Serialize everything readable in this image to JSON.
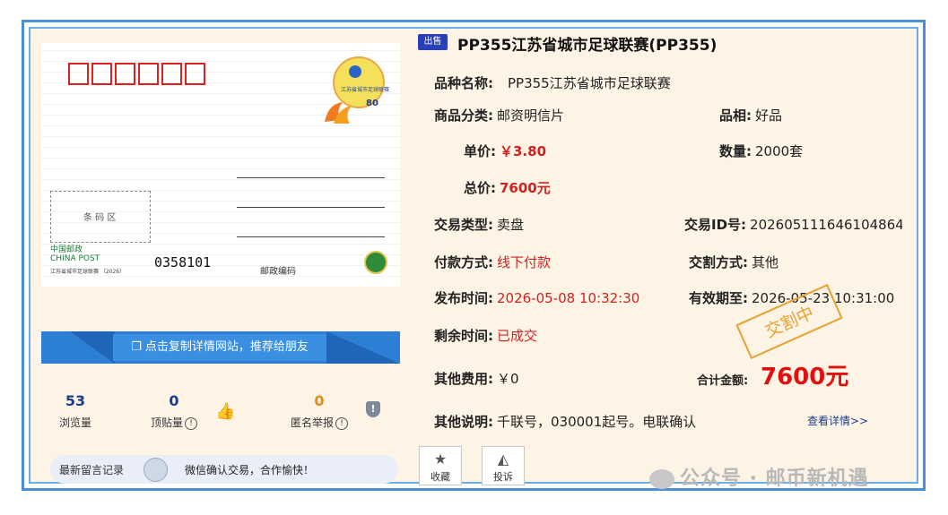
{
  "listing": {
    "badge": "出售",
    "title": "PP355江苏省城市足球联赛(PP355)"
  },
  "postcard": {
    "logo_text": "江苏省城市足球联赛",
    "logo_number": "80",
    "barcode_label": "条 码 区",
    "brand_cn": "中国邮政",
    "brand_en": "CHINA POST",
    "subtitle": "江苏省城市足球联赛 （2026）",
    "serial": "0358101",
    "postcode_label": "邮政编码"
  },
  "share": {
    "label": "点击复制详情网站，推荐给朋友"
  },
  "stats": {
    "views": {
      "value": "53",
      "label": "浏览量"
    },
    "tops": {
      "value": "0",
      "label": "顶贴量"
    },
    "reports": {
      "value": "0",
      "label": "匿名举报"
    }
  },
  "messages": {
    "label": "最新留言记录",
    "latest": "微信确认交易，合作愉快！"
  },
  "details": {
    "variety_label": "品种名称:",
    "variety_value": "PP355江苏省城市足球联赛",
    "category_label": "商品分类:",
    "category_value": "邮资明信片",
    "condition_label": "品相:",
    "condition_value": "好品",
    "unit_price_label": "单价:",
    "unit_price_value": "￥3.80",
    "quantity_label": "数量:",
    "quantity_value": "2000套",
    "total_label": "总价:",
    "total_value": "7600元",
    "trade_type_label": "交易类型:",
    "trade_type_value": "卖盘",
    "trade_id_label": "交易ID号:",
    "trade_id_value": "202605111646104864",
    "payment_label": "付款方式:",
    "payment_value": "线下付款",
    "delivery_label": "交割方式:",
    "delivery_value": "其他",
    "publish_label": "发布时间:",
    "publish_value": "2026-05-08 10:32:30",
    "valid_label": "有效期至:",
    "valid_value": "2026-05-23 10:31:00",
    "remaining_label": "剩余时间:",
    "remaining_value": "已成交",
    "other_fee_label": "其他费用:",
    "other_fee_value": "￥0",
    "sum_label": "合计金额:",
    "sum_value": "7600元",
    "stamp": "交割中",
    "notes_label": "其他说明:",
    "notes_value": "千联号，030001起号。电联确认",
    "more_link": "查看详情>>"
  },
  "actions": {
    "favorite": "收藏",
    "complain": "投诉"
  },
  "watermark": "公众号 · 邮币新机遇",
  "colors": {
    "accent": "#2d7fd6",
    "price_red": "#d42020",
    "stamp_orange": "#e8a030"
  }
}
